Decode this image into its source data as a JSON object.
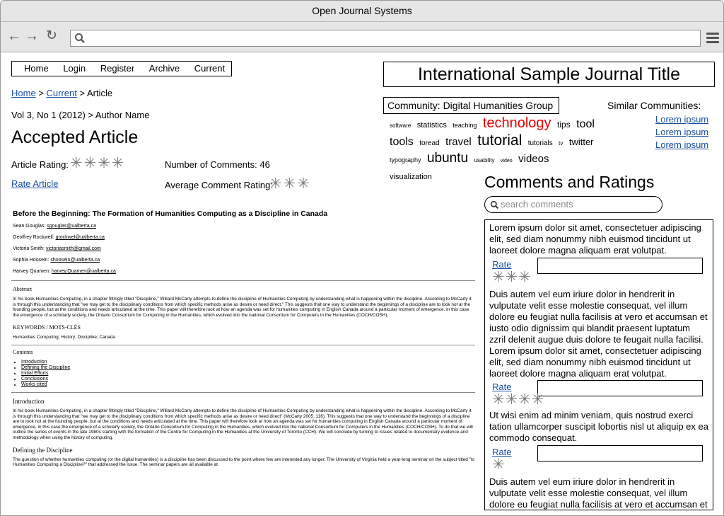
{
  "browser": {
    "title": "Open Journal Systems",
    "url": ""
  },
  "nav": {
    "items": [
      "Home",
      "Login",
      "Register",
      "Archive",
      "Current"
    ]
  },
  "breadcrumb": {
    "home": "Home",
    "sep1": ">",
    "current": "Current",
    "sep2": ">",
    "article": "Article"
  },
  "issue_line": "Vol 3, No 1 (2012) > Author Name",
  "page_title": "Accepted Article",
  "ratings": {
    "article_rating_label": "Article Rating:",
    "article_rating_value": 4,
    "comments_label": "Number of Comments: 46",
    "rate_article": "Rate Article",
    "avg_label": "Average Comment Rating:",
    "avg_value": 3
  },
  "article": {
    "title": "Before the Beginning: The Formation of Humanities Computing as a Discipline in Canada",
    "authors": [
      {
        "name": "Sean Gouglas:",
        "email": "sgouglas@ualberta.ca"
      },
      {
        "name": "Geoffrey Rockwell:",
        "email": "grockwel@ualberta.ca"
      },
      {
        "name": "Victoria Smith:",
        "email": "victoriasmith@gmail.com"
      },
      {
        "name": "Sophia Hoosein:",
        "email": "shoosein@ualberta.ca"
      },
      {
        "name": "Harvey Quamen:",
        "email": "harvey.Quamen@ualberta.ca"
      }
    ],
    "abstract_heading": "Abstract",
    "abstract_text": "In his book Humanities Computing, in a chapter fittingly titled \"Discipline,\" Willard McCarty attempts to define the discipline of Humanities Computing by understanding what is happening within the discipline. According to McCarty it is through this understanding that \"we may get to the disciplinary conditions from which specific methods arise as desire or need direct.\" This suggests that one way to understand the beginnings of a discipline are to look not at the founding people, but at the conditions and needs articulated at the time. This paper will therefore look at how an agenda was set for humanities computing in English Canada around a particular moment of emergence. In this case the emergence of a scholarly society, the Ontario Consortium for Computing in the Humanities, which evolved into the national Consortium for Computers in the Humanities (COCH/COSH).",
    "keywords_heading": "KEYWORDS / MOTS-CLÉS",
    "keywords": "Humanities Computing; History; Discipline; Canada",
    "contents_heading": "Contents",
    "contents": [
      "Introduction",
      "Defining the Discipline",
      "Initial Efforts",
      "Conclusions",
      "Works cited"
    ],
    "intro_heading": "Introduction",
    "intro_text": "In his book Humanities Computing, in a chapter fittingly titled \"Discipline,\" Willard McCarty attempts to define the discipline of Humanities Computing by understanding what is happening within the discipline. According to McCarty it is through this understanding that \"we may get to the disciplinary conditions from which specific methods arise as desire or need direct\" (McCarty 2005, 116). This suggests that one way to understand the beginnings of a discipline are to look not at the founding people, but at the conditions and needs articulated at the time. This paper will therefore look at how an agenda was set for humanities computing in English Canada around a particular moment of emergence, in this case the emergence of a scholarly society, the Ontario Consortium for Computing in the Humanities, which evolved into the national Consortium for Computers in the Humanities (COCH/COSH). To do that we will outline the series of events in the late 1980s starting with the formation of the Centre for Computing in the Humanities at the University of Toronto (CCH). We will conclude by turning to issues related to documentary evidence and methodology when using the history of computing.",
    "defining_heading": "Defining the Discipline",
    "defining_text": "The question of whether humanities computing (or the digital humanities) is a discipline has been discussed to the point where few are interested any longer. The University of Virginia held a year-long seminar on the subject titled \"Is Humanities Computing a Discipline?\" that addressed the issue. The seminar papers are all available at"
  },
  "journal_title": "International Sample Journal Title",
  "community": "Community: Digital Humanities Group",
  "similar": {
    "heading": "Similar Communities:",
    "links": [
      "Lorem ipsum",
      "Lorem ipsum",
      "Lorem ipsum"
    ]
  },
  "tag_cloud": [
    {
      "text": "software",
      "size": 8
    },
    {
      "text": "statistics",
      "size": 11
    },
    {
      "text": "teaching",
      "size": 9
    },
    {
      "text": "technology",
      "size": 20,
      "color": "#e00000"
    },
    {
      "text": "tips",
      "size": 12
    },
    {
      "text": "tool",
      "size": 16
    },
    {
      "text": "tools",
      "size": 16
    },
    {
      "text": "toread",
      "size": 10
    },
    {
      "text": "travel",
      "size": 15
    },
    {
      "text": "tutorial",
      "size": 21
    },
    {
      "text": "tutorials",
      "size": 10
    },
    {
      "text": "tv",
      "size": 8
    },
    {
      "text": "twitter",
      "size": 13
    },
    {
      "text": "typography",
      "size": 9
    },
    {
      "text": "ubuntu",
      "size": 19
    },
    {
      "text": "usability",
      "size": 8
    },
    {
      "text": "video",
      "size": 7
    },
    {
      "text": "videos",
      "size": 15
    },
    {
      "text": "visualization",
      "size": 11
    }
  ],
  "comments": {
    "heading": "Comments and Ratings",
    "search_placeholder": "search comments",
    "items": [
      {
        "text": "Lorem ipsum dolor sit amet, consectetuer adipiscing elit, sed diam nonummy nibh euismod tincidunt ut laoreet dolore magna aliquam erat volutpat.",
        "rate_label": "Rate",
        "stars": 3
      },
      {
        "text": "Duis autem vel eum iriure dolor in hendrerit in vulputate velit esse molestie consequat, vel illum dolore eu feugiat nulla facilisis at vero et accumsan et iusto odio dignissim qui blandit praesent luptatum zzril delenit augue duis dolore te feugait nulla facilisi. Lorem ipsum dolor sit amet, consectetuer adipiscing elit, sed diam nonummy nibh euismod tincidunt ut laoreet dolore magna aliquam erat volutpat.",
        "rate_label": "Rate",
        "stars": 4
      },
      {
        "text": "Ut wisi enim ad minim veniam, quis nostrud exerci tation ullamcorper suscipit lobortis nisl ut aliquip ex ea commodo consequat.",
        "rate_label": "Rate",
        "stars": 1
      },
      {
        "text": "Duis autem vel eum iriure dolor in hendrerit in vulputate velit esse molestie consequat, vel illum dolore eu feugiat nulla facilisis at vero et accumsan et iusto odio dignissim qui blandit praesent luptatum zzril",
        "rate_label": "",
        "stars": 0
      }
    ]
  },
  "icons": {
    "back": "arrow-left-icon",
    "forward": "arrow-right-icon",
    "reload": "reload-icon",
    "search": "search-icon",
    "menu": "hamburger-menu-icon",
    "star": "asterisk-star-icon"
  },
  "colors": {
    "link": "#1a4fa0",
    "highlight_tag": "#e00000",
    "star": "#777777"
  }
}
